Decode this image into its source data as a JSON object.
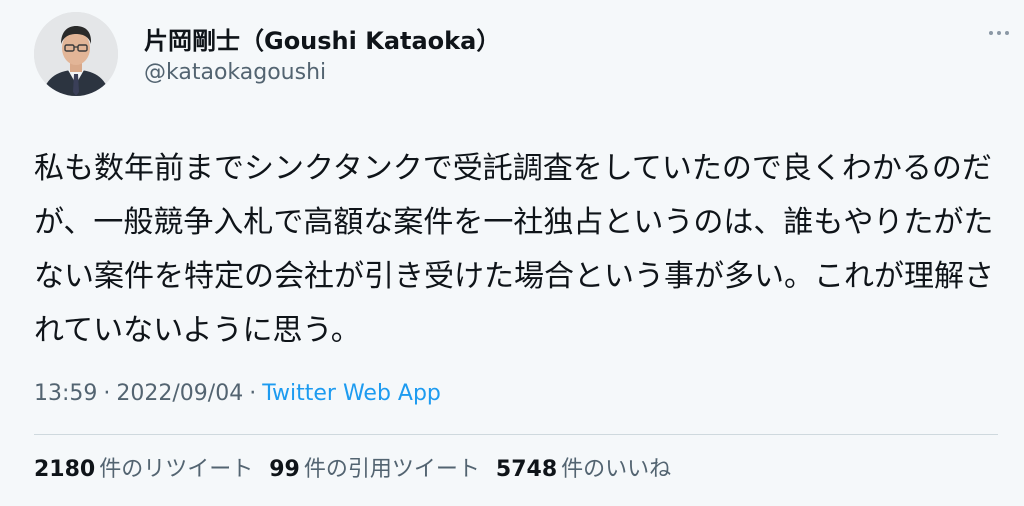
{
  "user": {
    "display_name": "片岡剛士（Goushi Kataoka）",
    "handle": "@kataokagoushi",
    "avatar_icon": "user-avatar-icon"
  },
  "more_icon": "ellipsis-icon",
  "tweet": {
    "text": "私も数年前までシンクタンクで受託調査をしていたので良くわかるのだが、一般競争入札で高額な案件を一社独占というのは、誰もやりたがたない案件を特定の会社が引き受けた場合という事が多い。これが理解されていないように思う。",
    "time": "13:59",
    "separator": "·",
    "date": "2022/09/04",
    "source": "Twitter Web App"
  },
  "stats": {
    "retweets": {
      "count": "2180",
      "label": "件のリツイート"
    },
    "quotes": {
      "count": "99",
      "label": "件の引用ツイート"
    },
    "likes": {
      "count": "5748",
      "label": "件のいいね"
    }
  },
  "colors": {
    "background": "#f5f8fa",
    "text": "#0f1419",
    "secondary": "#536471",
    "link": "#1d9bf0",
    "divider": "#cfd9de"
  }
}
